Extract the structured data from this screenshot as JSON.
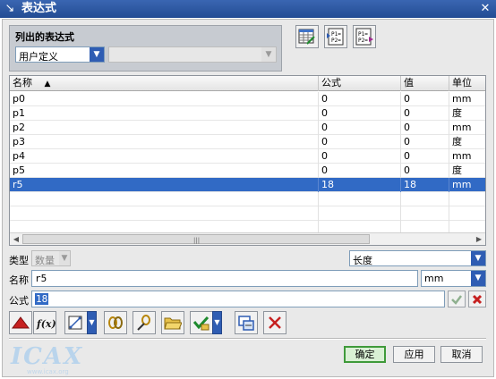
{
  "window": {
    "title": "表达式",
    "close_glyph": "✕"
  },
  "filter": {
    "label": "列出的表达式",
    "selected": "用户定义",
    "secondary_selected": ""
  },
  "toolbar_top": [
    {
      "icon": "spreadsheet-edit-icon"
    },
    {
      "icon": "list-references-icon",
      "text": "P1= P2="
    },
    {
      "icon": "list-expressions-icon",
      "text": "P1= P2="
    }
  ],
  "table": {
    "columns": [
      "名称",
      "公式",
      "值",
      "单位"
    ],
    "sort_indicator": "▲",
    "rows": [
      {
        "name": "p0",
        "formula": "0",
        "value": "0",
        "unit": "mm"
      },
      {
        "name": "p1",
        "formula": "0",
        "value": "0",
        "unit": "度"
      },
      {
        "name": "p2",
        "formula": "0",
        "value": "0",
        "unit": "mm"
      },
      {
        "name": "p3",
        "formula": "0",
        "value": "0",
        "unit": "度"
      },
      {
        "name": "p4",
        "formula": "0",
        "value": "0",
        "unit": "mm"
      },
      {
        "name": "p5",
        "formula": "0",
        "value": "0",
        "unit": "度"
      },
      {
        "name": "r5",
        "formula": "18",
        "value": "18",
        "unit": "mm"
      }
    ],
    "selected_index": 6,
    "scroll_grip": "|||"
  },
  "form": {
    "type_label": "类型",
    "type_value": "数量",
    "dimension_value": "长度",
    "name_label": "名称",
    "name_value": "r5",
    "unit_value": "mm",
    "formula_label": "公式",
    "formula_value": "18"
  },
  "action_icons": [
    "delete-expression-icon",
    "function-icon",
    "measure-distance-icon",
    "link-expression-icon",
    "edit-link-icon",
    "import-icon",
    "accept-edit-icon",
    "create-interpart-icon",
    "delete-icon"
  ],
  "buttons": {
    "ok": "确定",
    "apply": "应用",
    "cancel": "取消"
  },
  "watermark": {
    "logo": "ICAX",
    "url": "www.icax.org"
  },
  "colors": {
    "title_bar": "#234c93",
    "selection": "#316ac5",
    "ok_button_border": "#3f9a3a",
    "dropdown_arrow": "#2f5db3"
  }
}
